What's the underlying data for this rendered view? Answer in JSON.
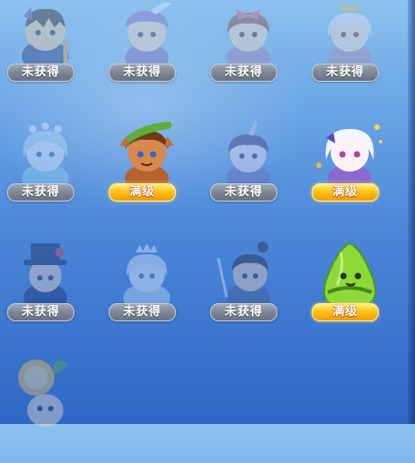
{
  "status_labels": {
    "locked": "未获得",
    "maxed": "满级"
  },
  "colors": {
    "background_top": "#8cc2ee",
    "background_bottom": "#2f67c6",
    "locked_badge": "#7d8694",
    "maxed_badge": "#ffc21c"
  },
  "pets": [
    {
      "row": 1,
      "col": 1,
      "icon": "knight-pet-icon",
      "status": "未获得"
    },
    {
      "row": 1,
      "col": 2,
      "icon": "feather-hat-girl-pet-icon",
      "status": "未获得"
    },
    {
      "row": 1,
      "col": 3,
      "icon": "bow-girl-pet-icon",
      "status": "未获得"
    },
    {
      "row": 1,
      "col": 4,
      "icon": "crown-princess-pet-icon",
      "status": "未获得"
    },
    {
      "row": 2,
      "col": 1,
      "icon": "mermaid-pet-icon",
      "status": "未获得"
    },
    {
      "row": 2,
      "col": 2,
      "icon": "jungle-warrior-pet-icon",
      "status": "满级"
    },
    {
      "row": 2,
      "col": 3,
      "icon": "horned-mage-pet-icon",
      "status": "未获得"
    },
    {
      "row": 2,
      "col": 4,
      "icon": "white-hair-girl-pet-icon",
      "status": "满级"
    },
    {
      "row": 3,
      "col": 1,
      "icon": "top-hat-gentleman-pet-icon",
      "status": "未获得"
    },
    {
      "row": 3,
      "col": 2,
      "icon": "ice-queen-pet-icon",
      "status": "未获得"
    },
    {
      "row": 3,
      "col": 3,
      "icon": "swordsman-pet-icon",
      "status": "未获得"
    },
    {
      "row": 3,
      "col": 4,
      "icon": "rice-dumpling-pet-icon",
      "status": "满级"
    },
    {
      "row": 4,
      "col": 1,
      "icon": "fruit-fairy-pet-icon"
    }
  ]
}
